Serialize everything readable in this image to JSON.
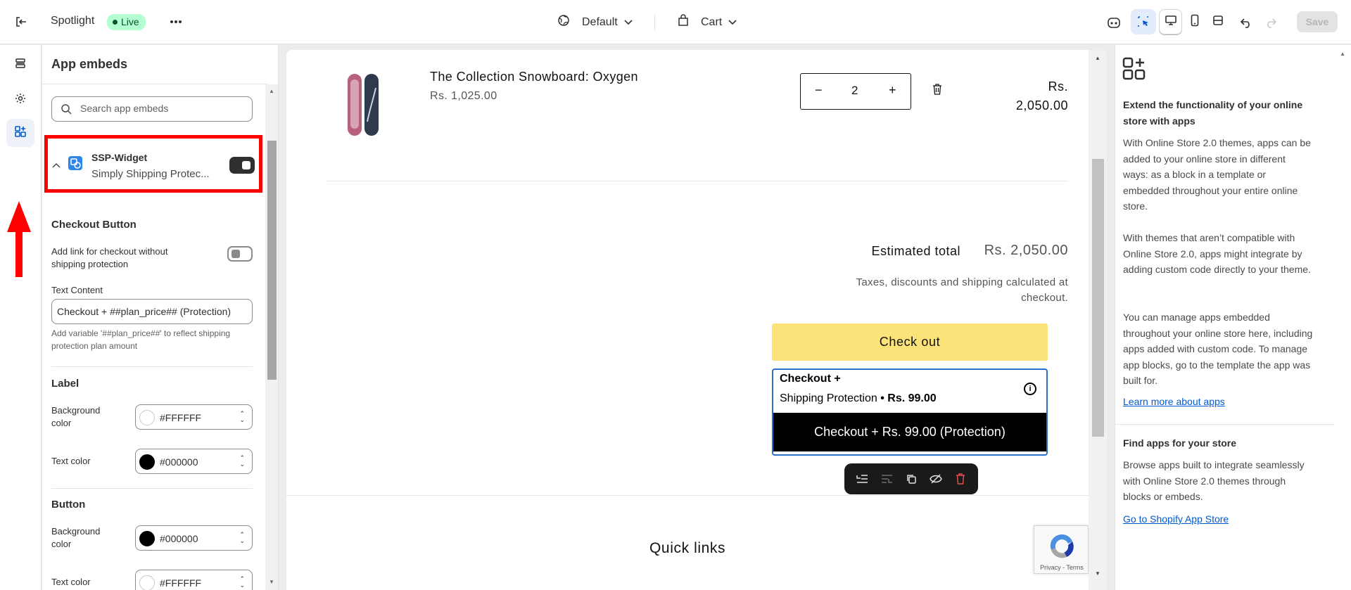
{
  "topbar": {
    "theme_name": "Spotlight",
    "status_badge": "Live",
    "template_selector": "Default",
    "page_selector": "Cart",
    "save_label": "Save"
  },
  "panel": {
    "title": "App embeds",
    "search_placeholder": "Search app embeds",
    "embed": {
      "name": "SSP-Widget",
      "description": "Simply Shipping Protec...",
      "enabled": true
    },
    "checkout_section": {
      "heading": "Checkout Button",
      "toggle_label": "Add link for checkout without shipping protection",
      "text_content_label": "Text Content",
      "text_content_value": "Checkout + ##plan_price## (Protection)",
      "help_text": "Add variable '##plan_price##' to reflect shipping protection plan amount"
    },
    "label_section": {
      "heading": "Label",
      "bg_label": "Background color",
      "bg_value": "#FFFFFF",
      "text_label": "Text color",
      "text_value": "#000000"
    },
    "button_section": {
      "heading": "Button",
      "bg_label": "Background color",
      "bg_value": "#000000",
      "text_label": "Text color",
      "text_value": "#FFFFFF"
    }
  },
  "preview": {
    "product_title": "The Collection Snowboard: Oxygen",
    "product_price": "Rs. 1,025.00",
    "quantity": "2",
    "line_total_currency": "Rs.",
    "line_total_amount": "2,050.00",
    "estimated_label": "Estimated total",
    "estimated_value": "Rs. 2,050.00",
    "taxes_note": "Taxes, discounts and shipping calculated at checkout.",
    "checkout_label": "Check out",
    "ssp": {
      "line1": "Checkout +",
      "line2_text": "Shipping Protection",
      "line2_price": "• Rs. 99.00",
      "button_label": "Checkout + Rs. 99.00 (Protection)"
    },
    "quick_links": "Quick links",
    "recaptcha_text": "Privacy - Terms"
  },
  "info_panel": {
    "heading1": "Extend the functionality of your online store with apps",
    "para1": "With Online Store 2.0 themes, apps can be added to your online store in different ways: as a block in a template or embedded throughout your entire online store.",
    "para2": "With themes that aren’t compatible with Online Store 2.0, apps might integrate by adding custom code directly to your theme.",
    "para3": "You can manage apps embedded throughout your online store here, including apps added with custom code. To manage app blocks, go to the template the app was built for.",
    "link1": "Learn more about apps",
    "heading2": "Find apps for your store",
    "para4": "Browse apps built to integrate seamlessly with Online Store 2.0 themes through blocks or embeds.",
    "link2": "Go to Shopify App Store"
  },
  "colors": {
    "accent": "#005bd3",
    "highlight": "#ff0000",
    "checkout_yellow": "#fbe37a"
  }
}
